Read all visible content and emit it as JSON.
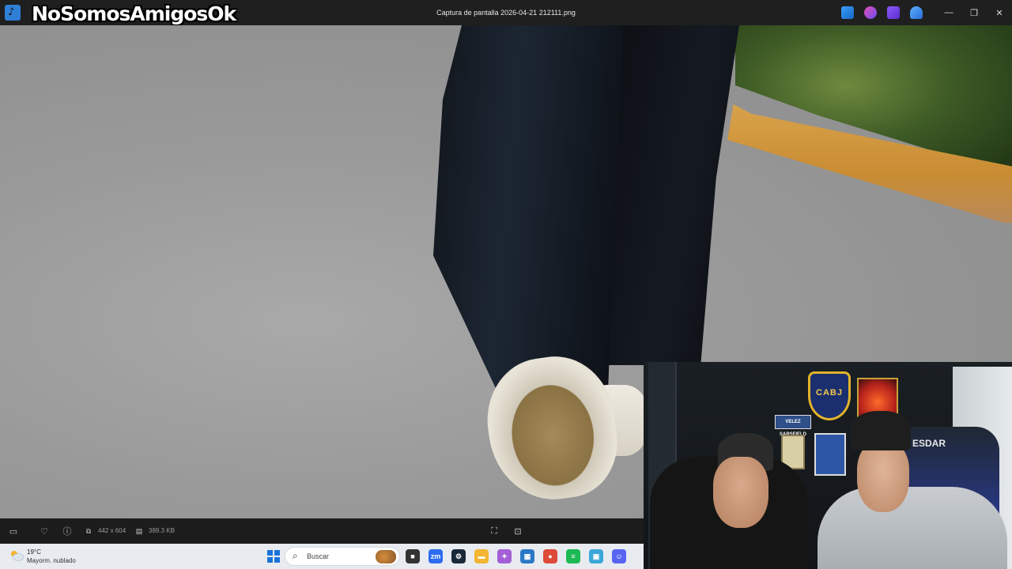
{
  "titlebar": {
    "window_title": "Captura de pantalla 2026-04-21 212111.png",
    "watermark": "NoSomosAmigosOk",
    "app_icon_glyph": "♪",
    "extension_icons": [
      "edit-icon",
      "copilot-icon",
      "clipchamp-icon",
      "onedrive-icon"
    ],
    "controls": {
      "minimize": "—",
      "restore": "❐",
      "close": "✕"
    }
  },
  "viewer_toolbar": {
    "dimensions": "442 x 604",
    "file_size": "389.3 KB",
    "icons": [
      "filmstrip-icon",
      "favorite-icon",
      "info-icon",
      "dimensions-icon",
      "filesize-icon",
      "fit-icon",
      "actual-size-icon"
    ]
  },
  "taskbar": {
    "weather": {
      "temp": "19°C",
      "condition": "Mayorm. nublado"
    },
    "search_placeholder": "Buscar",
    "apps": [
      {
        "name": "task-view",
        "glyph": "■",
        "color": "#333333"
      },
      {
        "name": "zoom",
        "glyph": "zm",
        "color": "#2d6cf0"
      },
      {
        "name": "steam",
        "glyph": "⚙",
        "color": "#1b2838"
      },
      {
        "name": "file-explorer",
        "glyph": "▬",
        "color": "#f2b632"
      },
      {
        "name": "copilot",
        "glyph": "✦",
        "color": "#a35fd6"
      },
      {
        "name": "store",
        "glyph": "▦",
        "color": "#2a78c6"
      },
      {
        "name": "chrome",
        "glyph": "●",
        "color": "#de4a3a"
      },
      {
        "name": "spotify",
        "glyph": "≡",
        "color": "#1db954"
      },
      {
        "name": "photos",
        "glyph": "▣",
        "color": "#3aa7d8"
      },
      {
        "name": "discord",
        "glyph": "☺",
        "color": "#5865f2"
      }
    ]
  },
  "webcam": {
    "shield_text": "CABJ",
    "plate_text": "VELEZ SARSFIELD",
    "chair_text": "ESDAR"
  }
}
